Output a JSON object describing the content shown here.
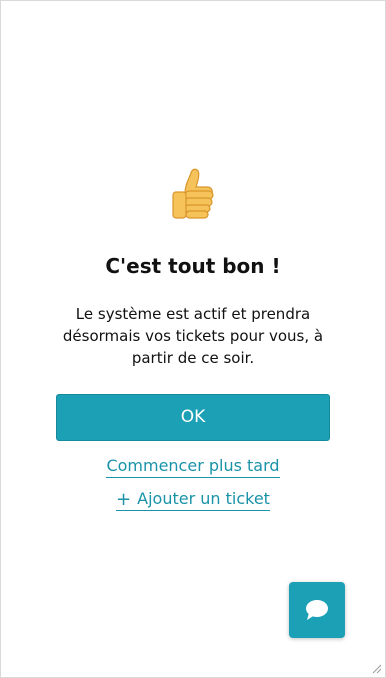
{
  "emoji": {
    "icon": "thumbs-up-icon",
    "skin_color": "#f6c35a"
  },
  "dialog": {
    "title": "C'est tout bon !",
    "message": "Le système est actif et prendra désormais vos tickets pour vous, à partir de ce soir.",
    "ok_label": "OK",
    "later_label": "Commencer plus tard",
    "add_label": "Ajouter un ticket",
    "add_icon": "plus-icon"
  },
  "chat": {
    "icon": "chat-bubble-icon"
  },
  "colors": {
    "accent": "#1ca0b6",
    "link": "#1a93a8",
    "text": "#111111"
  }
}
